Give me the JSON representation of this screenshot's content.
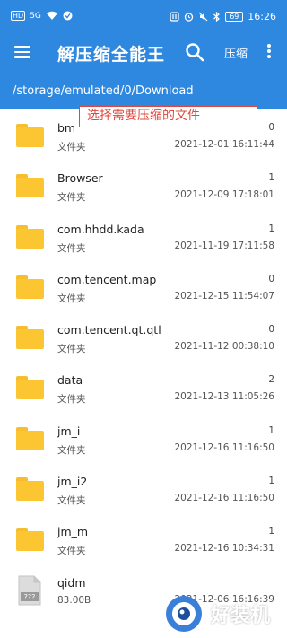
{
  "status_bar": {
    "carrier": "HD",
    "signal": "5G",
    "time": "16:26",
    "battery": "69"
  },
  "app_bar": {
    "title": "解压缩全能王",
    "compress_label": "压缩",
    "icons": [
      "menu-icon",
      "search-icon",
      "more-icon"
    ]
  },
  "path": "/storage/emulated/0/Download",
  "annotation": "选择需要压缩的文件",
  "files": [
    {
      "name": "bm",
      "type": "文件夹",
      "count": "0",
      "date": "2021-12-01 16:11:44",
      "icon": "folder-icon"
    },
    {
      "name": "Browser",
      "type": "文件夹",
      "count": "1",
      "date": "2021-12-09 17:18:01",
      "icon": "folder-icon"
    },
    {
      "name": "com.hhdd.kada",
      "type": "文件夹",
      "count": "1",
      "date": "2021-11-19 17:11:58",
      "icon": "folder-icon"
    },
    {
      "name": "com.tencent.map",
      "type": "文件夹",
      "count": "0",
      "date": "2021-12-15 11:54:07",
      "icon": "folder-icon"
    },
    {
      "name": "com.tencent.qt.qtl",
      "type": "文件夹",
      "count": "0",
      "date": "2021-11-12 00:38:10",
      "icon": "folder-icon"
    },
    {
      "name": "data",
      "type": "文件夹",
      "count": "2",
      "date": "2021-12-13 11:05:26",
      "icon": "folder-icon"
    },
    {
      "name": "jm_i",
      "type": "文件夹",
      "count": "1",
      "date": "2021-12-16 11:16:50",
      "icon": "folder-icon"
    },
    {
      "name": "jm_i2",
      "type": "文件夹",
      "count": "1",
      "date": "2021-12-16 11:16:50",
      "icon": "folder-icon"
    },
    {
      "name": "jm_m",
      "type": "文件夹",
      "count": "1",
      "date": "2021-12-16 10:34:31",
      "icon": "folder-icon"
    },
    {
      "name": "qidm",
      "type": "83.00B",
      "count": "",
      "date": "2021-12-06 16:16:39",
      "icon": "unknown-file-icon"
    }
  ],
  "watermark": "好装机",
  "colors": {
    "primary": "#2f88e0",
    "folder": "#fbc631",
    "annotation": "#e0483e"
  }
}
